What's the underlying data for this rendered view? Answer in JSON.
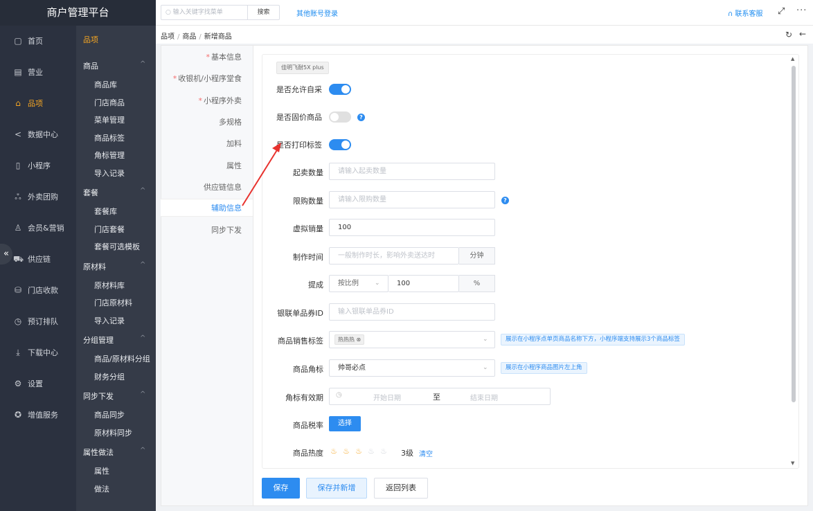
{
  "brand": "商户管理平台",
  "topbar": {
    "search_placeholder": "输入关键字找菜单",
    "search_button": "搜索",
    "other_login": "其他账号登录",
    "support": "联系客服"
  },
  "breadcrumb": {
    "l1": "品项",
    "l2": "商品",
    "l3": "新增商品"
  },
  "nav1": {
    "items": [
      {
        "label": "首页",
        "icon": "home-icon"
      },
      {
        "label": "营业",
        "icon": "calendar-icon"
      },
      {
        "label": "品项",
        "icon": "bag-icon"
      },
      {
        "label": "数据中心",
        "icon": "share-icon"
      },
      {
        "label": "小程序",
        "icon": "phone-icon"
      },
      {
        "label": "外卖团购",
        "icon": "group-icon"
      },
      {
        "label": "会员&营销",
        "icon": "user-icon"
      },
      {
        "label": "供应链",
        "icon": "truck-icon"
      },
      {
        "label": "门店收款",
        "icon": "wallet-icon"
      },
      {
        "label": "预订排队",
        "icon": "clock-icon"
      },
      {
        "label": "下载中心",
        "icon": "download-icon"
      },
      {
        "label": "设置",
        "icon": "gear-icon"
      },
      {
        "label": "增值服务",
        "icon": "badge-icon"
      }
    ],
    "active_index": 2
  },
  "nav2": {
    "title": "品项",
    "groups": [
      {
        "label": "商品",
        "items": [
          "商品库",
          "门店商品",
          "菜单管理",
          "商品标签",
          "角标管理",
          "导入记录"
        ]
      },
      {
        "label": "套餐",
        "items": [
          "套餐库",
          "门店套餐",
          "套餐可选模板"
        ]
      },
      {
        "label": "原材料",
        "items": [
          "原材料库",
          "门店原材料",
          "导入记录"
        ]
      },
      {
        "label": "分组管理",
        "items": [
          "商品/原材料分组",
          "财务分组"
        ]
      },
      {
        "label": "同步下发",
        "items": [
          "商品同步",
          "原材料同步"
        ]
      },
      {
        "label": "属性做法",
        "items": [
          "属性",
          "做法"
        ]
      }
    ]
  },
  "tabs": [
    {
      "label": "基本信息",
      "required": true
    },
    {
      "label": "收银机/小程序堂食",
      "required": true
    },
    {
      "label": "小程序外卖",
      "required": true
    },
    {
      "label": "多规格",
      "required": false
    },
    {
      "label": "加料",
      "required": false
    },
    {
      "label": "属性",
      "required": false
    },
    {
      "label": "供应链信息",
      "required": false
    },
    {
      "label": "辅助信息",
      "required": false
    },
    {
      "label": "同步下发",
      "required": false
    }
  ],
  "active_tab_index": 7,
  "form": {
    "product_chip": "佳明飞耐5X plus",
    "allow_self_purchase": {
      "label": "是否允许自采",
      "on": true
    },
    "fixed_price": {
      "label": "是否固价商品",
      "on": false
    },
    "print_label": {
      "label": "是否打印标签",
      "on": true
    },
    "min_qty": {
      "label": "起卖数量",
      "placeholder": "请输入起卖数量"
    },
    "limit_qty": {
      "label": "限购数量",
      "placeholder": "请输入限购数量"
    },
    "virtual_sales": {
      "label": "虚拟销量",
      "value": "100"
    },
    "prep_time": {
      "label": "制作时间",
      "placeholder": "一般制作时长，影响外卖送达时",
      "unit": "分钟"
    },
    "commission": {
      "label": "提成",
      "mode": "按比例",
      "value": "100",
      "unit": "%"
    },
    "unionpay_coupon": {
      "label": "银联单品券ID",
      "placeholder": "输入银联单品券ID"
    },
    "sales_tag": {
      "label": "商品销售标签",
      "chip": "热热热",
      "hint": "展示在小程序点单页商品名称下方，小程序端支持展示3个商品标签"
    },
    "corner_tag": {
      "label": "商品角标",
      "value": "帅哥必点",
      "hint": "展示在小程序商品图片左上角"
    },
    "corner_validity": {
      "label": "角标有效期",
      "start_placeholder": "开始日期",
      "sep": "至",
      "end_placeholder": "结束日期"
    },
    "tax_rate": {
      "label": "商品税率",
      "button": "选择"
    },
    "heat": {
      "label": "商品热度",
      "level_value": 3,
      "max": 5,
      "level_text": "3级",
      "clear": "清空"
    }
  },
  "footer": {
    "save": "保存",
    "save_new": "保存并新增",
    "back_list": "返回列表"
  },
  "colors": {
    "accent": "#2d8cf0",
    "nav_active": "#f5a623",
    "annotation_arrow": "#e8322e"
  }
}
